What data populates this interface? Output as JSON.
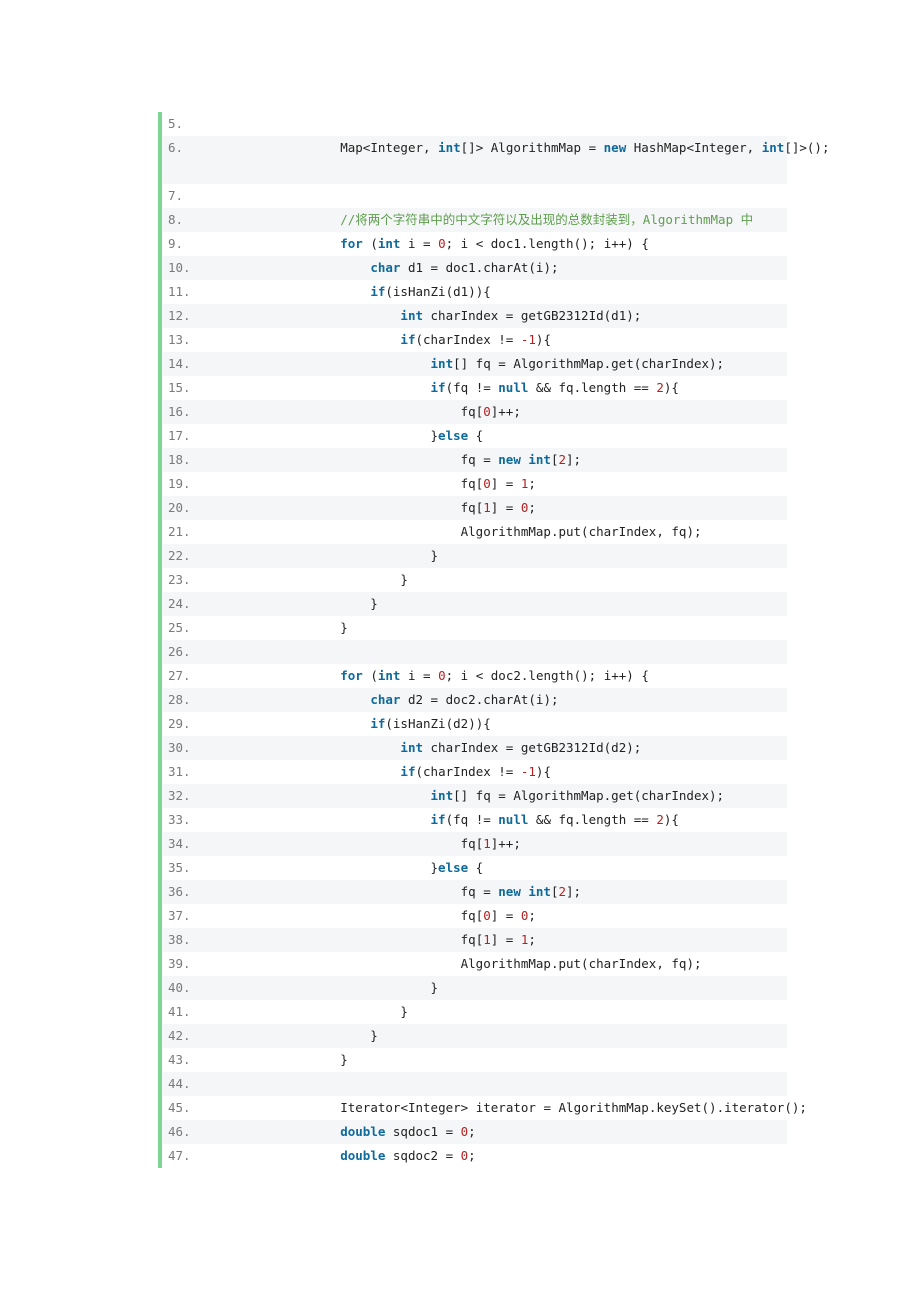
{
  "document": {
    "kind": "code-listing",
    "language": "java",
    "colors": {
      "accent_bar": "#7ed492",
      "keyword": "#0e6a9c",
      "number": "#b22222",
      "comment": "#5f9e4f",
      "plain": "#222222",
      "line_number": "#7a7a7a",
      "row_even_background": "#f5f6f7",
      "row_odd_background": "#ffffff",
      "page_background": "#ffffff"
    }
  },
  "code": {
    "first_line_number": 5,
    "last_line_number": 47,
    "lines": [
      {
        "n": "5.",
        "text": ""
      },
      {
        "n": "6.",
        "text": "        Map<Integer, int[]> AlgorithmMap = new HashMap<Integer, int[]>();"
      },
      {
        "n": "7.",
        "text": ""
      },
      {
        "n": "8.",
        "text": "        //将两个字符串中的中文字符以及出现的总数封装到，AlgorithmMap 中"
      },
      {
        "n": "9.",
        "text": "        for (int i = 0; i < doc1.length(); i++) {"
      },
      {
        "n": "10.",
        "text": "            char d1 = doc1.charAt(i);"
      },
      {
        "n": "11.",
        "text": "            if(isHanZi(d1)){"
      },
      {
        "n": "12.",
        "text": "                int charIndex = getGB2312Id(d1);"
      },
      {
        "n": "13.",
        "text": "                if(charIndex != -1){"
      },
      {
        "n": "14.",
        "text": "                    int[] fq = AlgorithmMap.get(charIndex);"
      },
      {
        "n": "15.",
        "text": "                    if(fq != null && fq.length == 2){"
      },
      {
        "n": "16.",
        "text": "                        fq[0]++;"
      },
      {
        "n": "17.",
        "text": "                    }else {"
      },
      {
        "n": "18.",
        "text": "                        fq = new int[2];"
      },
      {
        "n": "19.",
        "text": "                        fq[0] = 1;"
      },
      {
        "n": "20.",
        "text": "                        fq[1] = 0;"
      },
      {
        "n": "21.",
        "text": "                        AlgorithmMap.put(charIndex, fq);"
      },
      {
        "n": "22.",
        "text": "                    }"
      },
      {
        "n": "23.",
        "text": "                }"
      },
      {
        "n": "24.",
        "text": "            }"
      },
      {
        "n": "25.",
        "text": "        }"
      },
      {
        "n": "26.",
        "text": ""
      },
      {
        "n": "27.",
        "text": "        for (int i = 0; i < doc2.length(); i++) {"
      },
      {
        "n": "28.",
        "text": "            char d2 = doc2.charAt(i);"
      },
      {
        "n": "29.",
        "text": "            if(isHanZi(d2)){"
      },
      {
        "n": "30.",
        "text": "                int charIndex = getGB2312Id(d2);"
      },
      {
        "n": "31.",
        "text": "                if(charIndex != -1){"
      },
      {
        "n": "32.",
        "text": "                    int[] fq = AlgorithmMap.get(charIndex);"
      },
      {
        "n": "33.",
        "text": "                    if(fq != null && fq.length == 2){"
      },
      {
        "n": "34.",
        "text": "                        fq[1]++;"
      },
      {
        "n": "35.",
        "text": "                    }else {"
      },
      {
        "n": "36.",
        "text": "                        fq = new int[2];"
      },
      {
        "n": "37.",
        "text": "                        fq[0] = 0;"
      },
      {
        "n": "38.",
        "text": "                        fq[1] = 1;"
      },
      {
        "n": "39.",
        "text": "                        AlgorithmMap.put(charIndex, fq);"
      },
      {
        "n": "40.",
        "text": "                    }"
      },
      {
        "n": "41.",
        "text": "                }"
      },
      {
        "n": "42.",
        "text": "            }"
      },
      {
        "n": "43.",
        "text": "        }"
      },
      {
        "n": "44.",
        "text": ""
      },
      {
        "n": "45.",
        "text": "        Iterator<Integer> iterator = AlgorithmMap.keySet().iterator();"
      },
      {
        "n": "46.",
        "text": "        double sqdoc1 = 0;"
      },
      {
        "n": "47.",
        "text": "        double sqdoc2 = 0;"
      }
    ]
  }
}
